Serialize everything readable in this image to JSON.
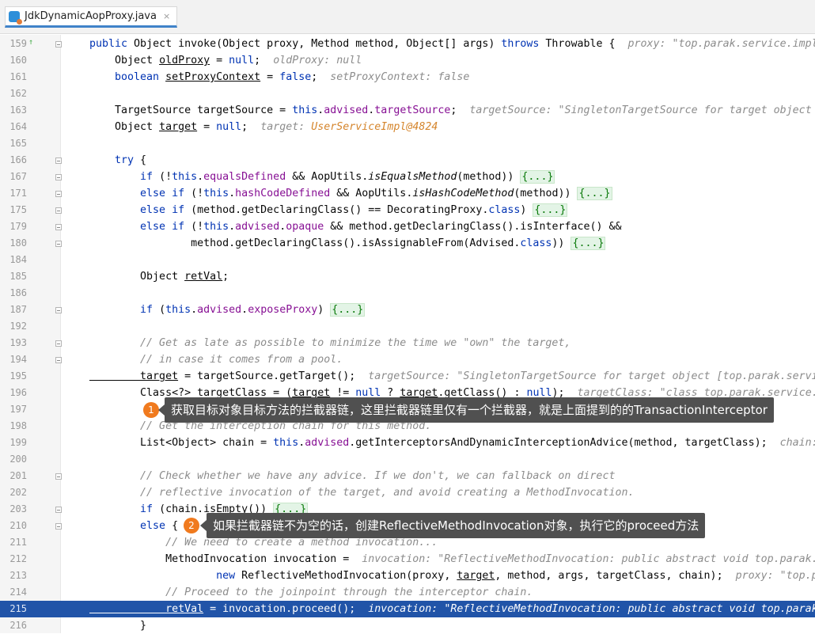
{
  "tab": {
    "label": "JdkDynamicAopProxy.java",
    "close": "×"
  },
  "lines": [
    {
      "n": "159",
      "mark": "↑",
      "fold": true,
      "parts": [
        [
          "kw",
          "public "
        ],
        [
          "",
          "Object "
        ],
        [
          "",
          "invoke(Object proxy, Method method, Object[] args) "
        ],
        [
          "kw",
          "throws "
        ],
        [
          "",
          "Throwable {  "
        ],
        [
          "hint",
          "proxy: \"top.parak.service.impl"
        ]
      ]
    },
    {
      "n": "160",
      "parts": [
        [
          "",
          "    Object "
        ],
        [
          "ul",
          "oldProxy"
        ],
        [
          "",
          " = "
        ],
        [
          "kw",
          "null"
        ],
        [
          "",
          ";  "
        ],
        [
          "hint",
          "oldProxy: null"
        ]
      ]
    },
    {
      "n": "161",
      "parts": [
        [
          "kw",
          "    boolean "
        ],
        [
          "ul",
          "setProxyContext"
        ],
        [
          "",
          " = "
        ],
        [
          "kw",
          "false"
        ],
        [
          "",
          ";  "
        ],
        [
          "hint",
          "setProxyContext: false"
        ]
      ]
    },
    {
      "n": "162",
      "parts": []
    },
    {
      "n": "163",
      "parts": [
        [
          "",
          "    TargetSource targetSource = "
        ],
        [
          "kw",
          "this"
        ],
        [
          "",
          "."
        ],
        [
          "fld",
          "advised"
        ],
        [
          "",
          "."
        ],
        [
          "fld",
          "targetSource"
        ],
        [
          "",
          ";  "
        ],
        [
          "hint",
          "targetSource: \"SingletonTargetSource for target object"
        ]
      ]
    },
    {
      "n": "164",
      "parts": [
        [
          "",
          "    Object "
        ],
        [
          "ul",
          "target"
        ],
        [
          "",
          " = "
        ],
        [
          "kw",
          "null"
        ],
        [
          "",
          ";  "
        ],
        [
          "hint",
          "target: "
        ],
        [
          "ho",
          "UserServiceImpl@4824"
        ]
      ]
    },
    {
      "n": "165",
      "parts": []
    },
    {
      "n": "166",
      "fold": true,
      "parts": [
        [
          "kw",
          "    try "
        ],
        [
          "",
          "{"
        ]
      ]
    },
    {
      "n": "167",
      "fold": true,
      "parts": [
        [
          "kw",
          "        if "
        ],
        [
          "",
          "(!"
        ],
        [
          "kw",
          "this"
        ],
        [
          "",
          "."
        ],
        [
          "fld",
          "equalsDefined"
        ],
        [
          "",
          " && AopUtils."
        ],
        [
          "it",
          "isEqualsMethod"
        ],
        [
          "",
          "(method)) "
        ],
        [
          "fb",
          "{...}"
        ]
      ]
    },
    {
      "n": "171",
      "fold": true,
      "parts": [
        [
          "kw",
          "        else if "
        ],
        [
          "",
          "(!"
        ],
        [
          "kw",
          "this"
        ],
        [
          "",
          "."
        ],
        [
          "fld",
          "hashCodeDefined"
        ],
        [
          "",
          " && AopUtils."
        ],
        [
          "it",
          "isHashCodeMethod"
        ],
        [
          "",
          "(method)) "
        ],
        [
          "fb",
          "{...}"
        ]
      ]
    },
    {
      "n": "175",
      "fold": true,
      "parts": [
        [
          "kw",
          "        else if "
        ],
        [
          "",
          "(method.getDeclaringClass() == DecoratingProxy."
        ],
        [
          "kw",
          "class"
        ],
        [
          "",
          ") "
        ],
        [
          "fb",
          "{...}"
        ]
      ]
    },
    {
      "n": "179",
      "fold": true,
      "parts": [
        [
          "kw",
          "        else if "
        ],
        [
          "",
          "(!"
        ],
        [
          "kw",
          "this"
        ],
        [
          "",
          "."
        ],
        [
          "fld",
          "advised"
        ],
        [
          "",
          "."
        ],
        [
          "fld",
          "opaque"
        ],
        [
          "",
          " && method.getDeclaringClass().isInterface() &&"
        ]
      ]
    },
    {
      "n": "180",
      "fold": true,
      "parts": [
        [
          "",
          "                method.getDeclaringClass().isAssignableFrom(Advised."
        ],
        [
          "kw",
          "class"
        ],
        [
          "",
          "))"
        ],
        [
          "",
          " "
        ],
        [
          "fb",
          "{...}"
        ]
      ]
    },
    {
      "n": "184",
      "parts": []
    },
    {
      "n": "185",
      "parts": [
        [
          "",
          "        Object "
        ],
        [
          "ul",
          "retVal"
        ],
        [
          "",
          ";"
        ]
      ]
    },
    {
      "n": "186",
      "parts": []
    },
    {
      "n": "187",
      "fold": true,
      "parts": [
        [
          "kw",
          "        if "
        ],
        [
          "",
          "("
        ],
        [
          "kw",
          "this"
        ],
        [
          "",
          "."
        ],
        [
          "fld",
          "advised"
        ],
        [
          "",
          "."
        ],
        [
          "fld",
          "exposeProxy"
        ],
        [
          "",
          ") "
        ],
        [
          "fb",
          "{...}"
        ]
      ]
    },
    {
      "n": "192",
      "parts": []
    },
    {
      "n": "193",
      "fold": true,
      "parts": [
        [
          "cm",
          "        // Get as late as possible to minimize the time we \"own\" the target,"
        ]
      ]
    },
    {
      "n": "194",
      "fold": true,
      "parts": [
        [
          "cm",
          "        // in case it comes from a pool."
        ]
      ]
    },
    {
      "n": "195",
      "parts": [
        [
          "ul",
          "        target"
        ],
        [
          "",
          " = targetSource.getTarget();  "
        ],
        [
          "hint",
          "targetSource: \"SingletonTargetSource for target object [top.parak.servi"
        ]
      ]
    },
    {
      "n": "196",
      "parts": [
        [
          "",
          "        Class<?> targetClass = ("
        ],
        [
          "ul",
          "target"
        ],
        [
          "",
          " != "
        ],
        [
          "kw",
          "null"
        ],
        [
          "",
          " ? "
        ],
        [
          "ul",
          "target"
        ],
        [
          "",
          ".getClass() : "
        ],
        [
          "kw",
          "null"
        ],
        [
          "",
          ");  "
        ],
        [
          "hint",
          "targetClass: \"class top.parak.service."
        ]
      ]
    },
    {
      "n": "197",
      "parts": []
    },
    {
      "n": "198",
      "parts": [
        [
          "cm",
          "        // Get the interception chain for this method."
        ]
      ]
    },
    {
      "n": "199",
      "parts": [
        [
          "",
          "        List<Object> chain = "
        ],
        [
          "kw",
          "this"
        ],
        [
          "",
          "."
        ],
        [
          "fld",
          "advised"
        ],
        [
          "",
          ".getInterceptorsAndDynamicInterceptionAdvice(method, targetClass);  "
        ],
        [
          "hint",
          "chain:"
        ]
      ]
    },
    {
      "n": "200",
      "parts": []
    },
    {
      "n": "201",
      "fold": true,
      "parts": [
        [
          "cm",
          "        // Check whether we have any advice. If we don't, we can fallback on direct"
        ]
      ]
    },
    {
      "n": "202",
      "parts": [
        [
          "cm",
          "        // reflective invocation of the target, and avoid creating a MethodInvocation."
        ]
      ]
    },
    {
      "n": "203",
      "fold": true,
      "parts": [
        [
          "kw",
          "        if "
        ],
        [
          "",
          "(chain.isEmpty()) "
        ],
        [
          "fb",
          "{...}"
        ]
      ]
    },
    {
      "n": "210",
      "fold": true,
      "parts": [
        [
          "kw",
          "        else "
        ],
        [
          "",
          "{"
        ]
      ]
    },
    {
      "n": "211",
      "parts": [
        [
          "cm",
          "            // We need to create a method invocation..."
        ]
      ]
    },
    {
      "n": "212",
      "parts": [
        [
          "",
          "            MethodInvocation invocation =  "
        ],
        [
          "hint",
          "invocation: \"ReflectiveMethodInvocation: public abstract void top.parak."
        ]
      ]
    },
    {
      "n": "213",
      "parts": [
        [
          "kw",
          "                    new "
        ],
        [
          "",
          "ReflectiveMethodInvocation(proxy, "
        ],
        [
          "ul",
          "target"
        ],
        [
          "",
          ", method, args, targetClass, chain);  "
        ],
        [
          "hint",
          "proxy: \"top.p"
        ]
      ]
    },
    {
      "n": "214",
      "parts": [
        [
          "cm",
          "            // Proceed to the joinpoint through the interceptor chain."
        ]
      ]
    },
    {
      "n": "215",
      "hl": true,
      "parts": [
        [
          "ul",
          "            retVal"
        ],
        [
          "",
          " = invocation.proceed();  "
        ],
        [
          "hint",
          "invocation: \"ReflectiveMethodInvocation: public abstract void top.parak"
        ]
      ]
    },
    {
      "n": "216",
      "parts": [
        [
          "",
          "        }"
        ]
      ]
    }
  ],
  "callouts": [
    {
      "badge": "1",
      "text": "获取目标对象目标方法的拦截器链，这里拦截器链里仅有一个拦截器，就是上面提到的的TransactionInterceptor"
    },
    {
      "badge": "2",
      "text": "如果拦截器链不为空的话，创建ReflectiveMethodInvocation对象，执行它的proceed方法"
    }
  ]
}
